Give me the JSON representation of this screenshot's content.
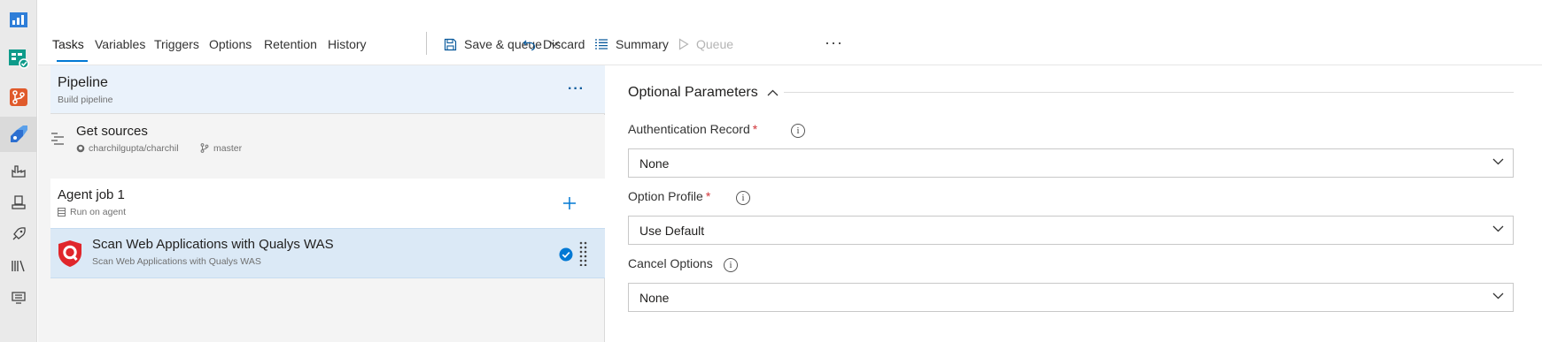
{
  "rail": {
    "items": [
      {
        "icon": "overview-icon",
        "active": false
      },
      {
        "icon": "boards-icon",
        "active": false
      },
      {
        "icon": "repos-icon",
        "active": false
      },
      {
        "icon": "pipelines-icon",
        "active": true
      },
      {
        "icon": "builds-icon",
        "active": false
      },
      {
        "icon": "agent-pools-icon",
        "active": false
      },
      {
        "icon": "releases-icon",
        "active": false
      },
      {
        "icon": "library-icon",
        "active": false
      },
      {
        "icon": "task-groups-icon",
        "active": false
      }
    ]
  },
  "toolbar": {
    "tabs": [
      {
        "label": "Tasks",
        "active": true
      },
      {
        "label": "Variables",
        "active": false
      },
      {
        "label": "Triggers",
        "active": false
      },
      {
        "label": "Options",
        "active": false
      },
      {
        "label": "Retention",
        "active": false
      },
      {
        "label": "History",
        "active": false
      }
    ],
    "save_queue_label": "Save & queue",
    "discard_label": "Discard",
    "summary_label": "Summary",
    "queue_label": "Queue",
    "more_label": "···"
  },
  "pipeline": {
    "title": "Pipeline",
    "subtitle": "Build pipeline",
    "more_label": "···"
  },
  "sources": {
    "title": "Get sources",
    "repo": "charchilgupta/charchil",
    "branch": "master"
  },
  "agent_job": {
    "title": "Agent job 1",
    "subtitle": "Run on agent"
  },
  "task": {
    "title": "Scan Web Applications with Qualys WAS",
    "subtitle": "Scan Web Applications with Qualys WAS"
  },
  "details": {
    "section_title": "Optional Parameters",
    "fields": [
      {
        "label": "Authentication Record",
        "required": true,
        "value": "None"
      },
      {
        "label": "Option Profile",
        "required": true,
        "value": "Use Default"
      },
      {
        "label": "Cancel Options",
        "required": false,
        "value": "None"
      }
    ],
    "required_marker": "*",
    "info_glyph": "i"
  },
  "colors": {
    "accent": "#0078d4",
    "selected_row": "#dbe9f6",
    "pipeline_row": "#eaf2fb",
    "required": "#d13438",
    "qualys_red": "#e0262b"
  }
}
